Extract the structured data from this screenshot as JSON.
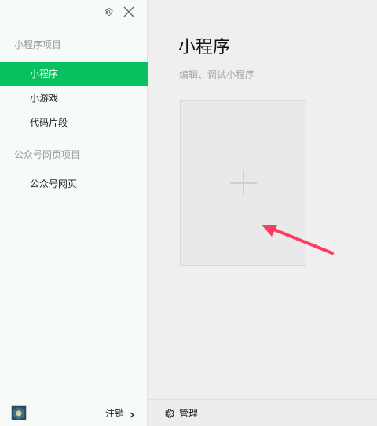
{
  "sidebar": {
    "sections": [
      {
        "label": "小程序项目",
        "items": [
          {
            "label": "小程序",
            "active": true
          },
          {
            "label": "小游戏",
            "active": false
          },
          {
            "label": "代码片段",
            "active": false
          }
        ]
      },
      {
        "label": "公众号网页项目",
        "items": [
          {
            "label": "公众号网页",
            "active": false
          }
        ]
      }
    ],
    "footer": {
      "logout_label": "注销"
    }
  },
  "main": {
    "title": "小程序",
    "subtitle": "编辑、调试小程序",
    "footer": {
      "manage_label": "管理"
    }
  },
  "colors": {
    "accent": "#07c160",
    "sidebar_bg": "#f6fbf8",
    "main_bg": "#efefef",
    "arrow": "#ff3b5f"
  },
  "icons": {
    "settings": "gear-icon",
    "close": "close-icon",
    "add": "plus-icon",
    "chevron": "chevron-right-icon",
    "avatar": "avatar-image"
  }
}
